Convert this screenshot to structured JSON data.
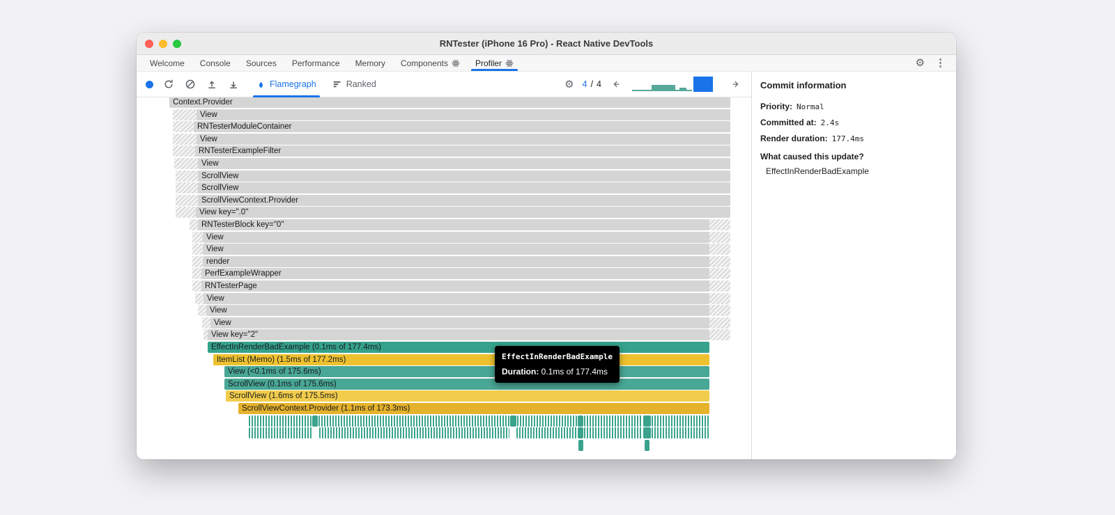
{
  "window": {
    "title": "RNTester (iPhone 16 Pro) - React Native DevTools"
  },
  "tabbar": {
    "tabs": [
      {
        "label": "Welcome",
        "atom": false,
        "active": false
      },
      {
        "label": "Console",
        "atom": false,
        "active": false
      },
      {
        "label": "Sources",
        "atom": false,
        "active": false
      },
      {
        "label": "Performance",
        "atom": false,
        "active": false
      },
      {
        "label": "Memory",
        "atom": false,
        "active": false
      },
      {
        "label": "Components",
        "atom": true,
        "active": false
      },
      {
        "label": "Profiler",
        "atom": true,
        "active": true
      }
    ]
  },
  "toolbar": {
    "views": [
      {
        "label": "Flamegraph",
        "active": true
      },
      {
        "label": "Ranked",
        "active": false
      }
    ],
    "commit_selector": {
      "current": "4",
      "separator": "/",
      "total": "4"
    }
  },
  "commit_info": {
    "title": "Commit information",
    "fields": [
      {
        "label": "Priority:",
        "value": "Normal"
      },
      {
        "label": "Committed at:",
        "value": "2.4s"
      },
      {
        "label": "Render duration:",
        "value": "177.4ms"
      }
    ],
    "cause_label": "What caused this update?",
    "causes": [
      "EffectInRenderBadExample"
    ]
  },
  "tooltip": {
    "name": "EffectInRenderBadExample",
    "duration_label": "Duration:",
    "duration_value": "0.1ms of 177.4ms"
  },
  "colors": {
    "accent_blue": "#1a73e8",
    "bar_gray": "#d5d5d5",
    "teal": "#36a28b",
    "teal_light": "#49a795",
    "yellow": "#eec22f",
    "yellow_light": "#f2cd4c",
    "gold": "#e5b22c",
    "dense_teal": "#3aa38c"
  },
  "flamegraph": {
    "rows": [
      {
        "label": "Context.Provider",
        "bar": [
          47,
          852
        ],
        "type": "gray"
      },
      {
        "label": "View",
        "stripe": [
          52,
          86
        ],
        "bar": [
          86,
          852
        ],
        "type": "gray"
      },
      {
        "label": "RNTesterModuleContainer",
        "stripe": [
          52,
          82
        ],
        "bar": [
          82,
          852
        ],
        "type": "gray"
      },
      {
        "label": "View",
        "stripe": [
          52,
          86
        ],
        "bar": [
          86,
          852
        ],
        "type": "gray"
      },
      {
        "label": "RNTesterExampleFilter",
        "stripe": [
          52,
          84
        ],
        "bar": [
          84,
          852
        ],
        "type": "gray"
      },
      {
        "label": "View",
        "stripe": [
          54,
          88
        ],
        "bar": [
          88,
          852
        ],
        "type": "gray"
      },
      {
        "label": "ScrollView",
        "stripe": [
          56,
          88
        ],
        "bar": [
          88,
          852
        ],
        "type": "gray"
      },
      {
        "label": "ScrollView",
        "stripe": [
          56,
          88
        ],
        "bar": [
          88,
          852
        ],
        "type": "gray"
      },
      {
        "label": "ScrollViewContext.Provider",
        "stripe": [
          56,
          88
        ],
        "bar": [
          88,
          852
        ],
        "type": "gray"
      },
      {
        "label": "View key=\".0\"",
        "stripe": [
          56,
          85
        ],
        "bar": [
          85,
          852
        ],
        "type": "gray"
      },
      {
        "label": "RNTesterBlock key=\"0\"",
        "stripe": [
          76,
          88
        ],
        "bar": [
          88,
          822
        ],
        "rstripe": 852,
        "type": "gray"
      },
      {
        "label": "View",
        "stripe": [
          80,
          95
        ],
        "bar": [
          95,
          822
        ],
        "rstripe": 852,
        "type": "gray"
      },
      {
        "label": "View",
        "stripe": [
          80,
          95
        ],
        "bar": [
          95,
          822
        ],
        "rstripe": 852,
        "type": "gray"
      },
      {
        "label": "render",
        "stripe": [
          80,
          95
        ],
        "bar": [
          95,
          822
        ],
        "rstripe": 852,
        "type": "gray"
      },
      {
        "label": "PerfExampleWrapper",
        "stripe": [
          80,
          93
        ],
        "bar": [
          93,
          822
        ],
        "rstripe": 852,
        "type": "gray"
      },
      {
        "label": "RNTesterPage",
        "stripe": [
          80,
          93
        ],
        "bar": [
          93,
          822
        ],
        "rstripe": 852,
        "type": "gray"
      },
      {
        "label": "View",
        "stripe": [
          84,
          96
        ],
        "bar": [
          96,
          822
        ],
        "rstripe": 852,
        "type": "gray"
      },
      {
        "label": "View",
        "stripe": [
          88,
          100
        ],
        "bar": [
          100,
          822
        ],
        "rstripe": 852,
        "type": "gray"
      },
      {
        "label": "View",
        "stripe": [
          94,
          106
        ],
        "bar": [
          106,
          822
        ],
        "rstripe": 852,
        "type": "gray"
      },
      {
        "label": "View key=\"2\"",
        "stripe": [
          96,
          102
        ],
        "bar": [
          102,
          822
        ],
        "rstripe": 852,
        "type": "gray"
      },
      {
        "label": "EffectInRenderBadExample (0.1ms of 177.4ms)",
        "bar": [
          102,
          822
        ],
        "type": "teal"
      },
      {
        "label": "ItemList (Memo) (1.5ms of 177.2ms)",
        "bar": [
          110,
          822
        ],
        "type": "yellow"
      },
      {
        "label": "View (<0.1ms of 175.6ms)",
        "bar": [
          126,
          822
        ],
        "type": "teal2"
      },
      {
        "label": "ScrollView (0.1ms of 175.6ms)",
        "bar": [
          126,
          822
        ],
        "type": "teal2"
      },
      {
        "label": "ScrollView (1.6ms of 175.5ms)",
        "bar": [
          128,
          822
        ],
        "type": "yellow2"
      },
      {
        "label": "ScrollViewContext.Provider (1.1ms of 173.3ms)",
        "bar": [
          146,
          822
        ],
        "type": "gold"
      },
      {
        "type": "dense",
        "segments": [
          [
            161,
            251
          ],
          [
            261,
            535
          ],
          [
            546,
            632
          ],
          [
            642,
            726
          ],
          [
            739,
            822
          ]
        ],
        "accents": [
          [
            252,
            8
          ],
          [
            536,
            9
          ],
          [
            633,
            8
          ],
          [
            727,
            11
          ]
        ]
      },
      {
        "type": "dense",
        "segments": [
          [
            161,
            252
          ],
          [
            262,
            535
          ],
          [
            545,
            632
          ],
          [
            642,
            726
          ],
          [
            739,
            822
          ]
        ],
        "accents": [
          [
            633,
            8
          ],
          [
            727,
            11
          ]
        ]
      },
      {
        "type": "dense",
        "segments": [],
        "accents": [
          [
            634,
            7
          ],
          [
            729,
            7
          ]
        ]
      }
    ]
  }
}
